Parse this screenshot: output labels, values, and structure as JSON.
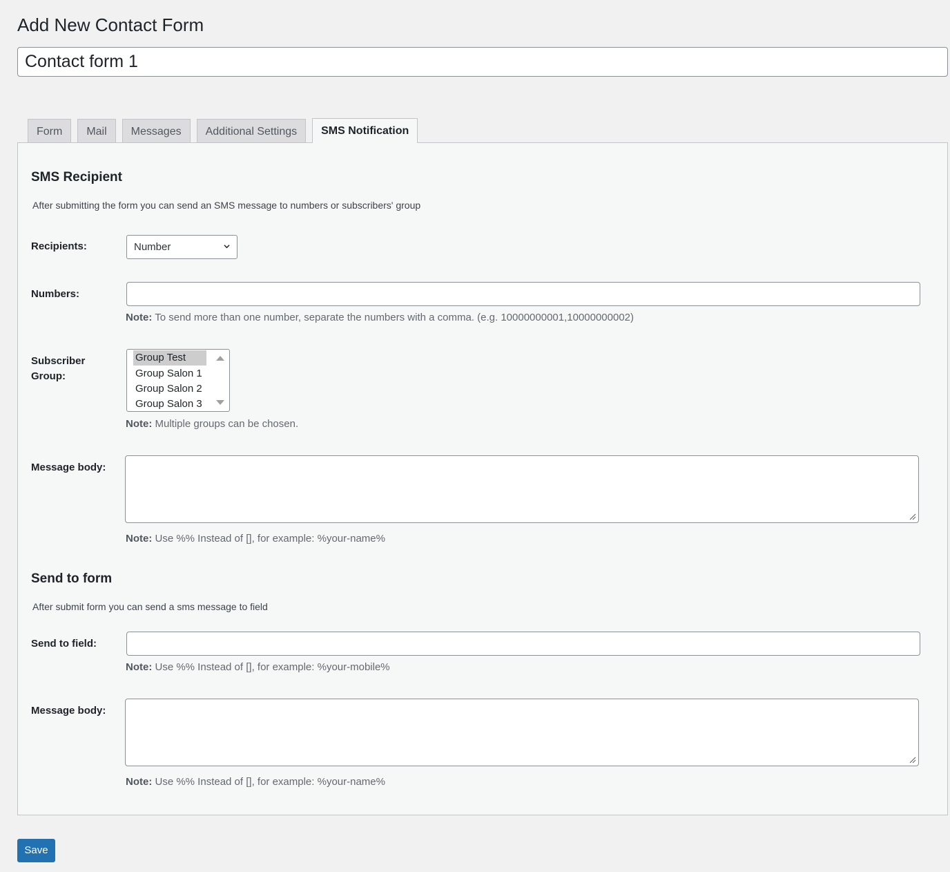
{
  "page": {
    "title": "Add New Contact Form",
    "form_title_value": "Contact form 1"
  },
  "tabs": [
    {
      "label": "Form",
      "active": false
    },
    {
      "label": "Mail",
      "active": false
    },
    {
      "label": "Messages",
      "active": false
    },
    {
      "label": "Additional Settings",
      "active": false
    },
    {
      "label": "SMS Notification",
      "active": true
    }
  ],
  "sms_recipient": {
    "title": "SMS Recipient",
    "description": "After submitting the form you can send an SMS message to numbers or subscribers' group",
    "recipients_label": "Recipients:",
    "recipients_value": "Number",
    "numbers_label": "Numbers:",
    "numbers_value": "",
    "numbers_note_prefix": "Note:",
    "numbers_note": " To send more than one number, separate the numbers with a comma. (e.g. 10000000001,10000000002)",
    "subscriber_group_label": "Subscriber Group:",
    "subscriber_group_options": [
      "Group Test",
      "Group Salon 1",
      "Group Salon 2",
      "Group Salon 3"
    ],
    "subscriber_group_selected": "Group Test",
    "subscriber_group_note_prefix": "Note:",
    "subscriber_group_note": " Multiple groups can be chosen.",
    "message_body_label": "Message body:",
    "message_body_value": "",
    "message_body_note_prefix": "Note:",
    "message_body_note": " Use %% Instead of [], for example: %your-name%"
  },
  "send_to_form": {
    "title": "Send to form",
    "description": "After submit form you can send a sms message to field",
    "field_label": "Send to field:",
    "field_value": "",
    "field_note_prefix": "Note:",
    "field_note": " Use %% Instead of [], for example: %your-mobile%",
    "message_body_label": "Message body:",
    "message_body_value": "",
    "message_body_note_prefix": "Note:",
    "message_body_note": " Use %% Instead of [], for example: %your-name%"
  },
  "actions": {
    "save_label": "Save"
  },
  "colors": {
    "primary": "#2271b1",
    "background": "#f1f1f1",
    "panel": "#f6f7f7"
  }
}
